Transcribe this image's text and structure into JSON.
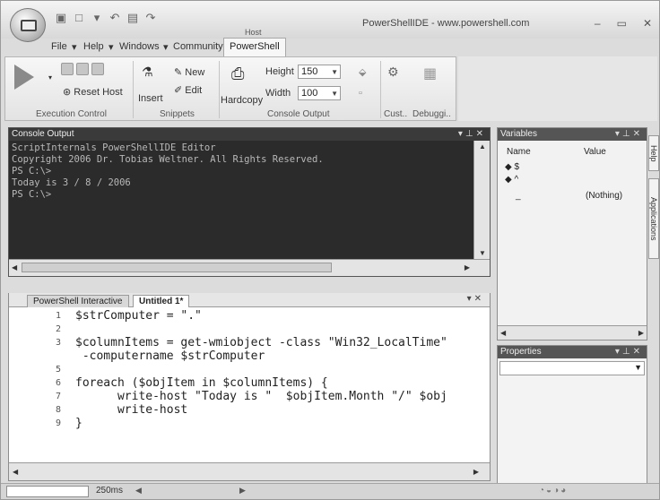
{
  "window": {
    "title": "PowerShellIDE - www.powershell.com",
    "context_header": "Host"
  },
  "menu": {
    "file": "File",
    "help": "Help",
    "windows": "Windows",
    "community": "Community",
    "active_tab": "PowerShell"
  },
  "ribbon": {
    "reset_host": "Reset Host",
    "insert": "Insert",
    "new": "New",
    "edit": "Edit",
    "hardcopy": "Hardcopy",
    "height_label": "Height",
    "height_value": "150",
    "width_label": "Width",
    "width_value": "100",
    "groups": [
      "Execution Control",
      "Snippets",
      "Console Output",
      "Cust..",
      "Debuggi.."
    ]
  },
  "console": {
    "title": "Console Output",
    "lines": [
      "ScriptInternals PowerShellIDE Editor",
      "Copyright  2006 Dr. Tobias Weltner. All Rights Reserved.",
      "PS C:\\>",
      "Today is  3 / 8 / 2006",
      "PS C:\\>"
    ]
  },
  "variables": {
    "title": "Variables",
    "col_name": "Name",
    "col_value": "Value",
    "rows": [
      {
        "name": "$",
        "value": ""
      },
      {
        "name": "^",
        "value": ""
      },
      {
        "name": "_",
        "value": "(Nothing)"
      }
    ]
  },
  "properties": {
    "title": "Properties"
  },
  "side_tabs": [
    "Help",
    "Applications"
  ],
  "editor": {
    "tabs": [
      "PowerShell Interactive",
      "Untitled 1*"
    ],
    "lines": [
      {
        "n": "1",
        "text": "$strComputer = \".\""
      },
      {
        "n": "2",
        "text": ""
      },
      {
        "n": "3",
        "text": "$columnItems = get-wmiobject -class \"Win32_LocalTime\""
      },
      {
        "n": "",
        "text": " -computername $strComputer"
      },
      {
        "n": "5",
        "text": ""
      },
      {
        "n": "6",
        "text": "foreach ($objItem in $columnItems) {"
      },
      {
        "n": "7",
        "text": "      write-host \"Today is \"  $objItem.Month \"/\" $obj"
      },
      {
        "n": "8",
        "text": "      write-host"
      },
      {
        "n": "9",
        "text": "}"
      }
    ]
  },
  "status": {
    "timing": "250ms"
  }
}
